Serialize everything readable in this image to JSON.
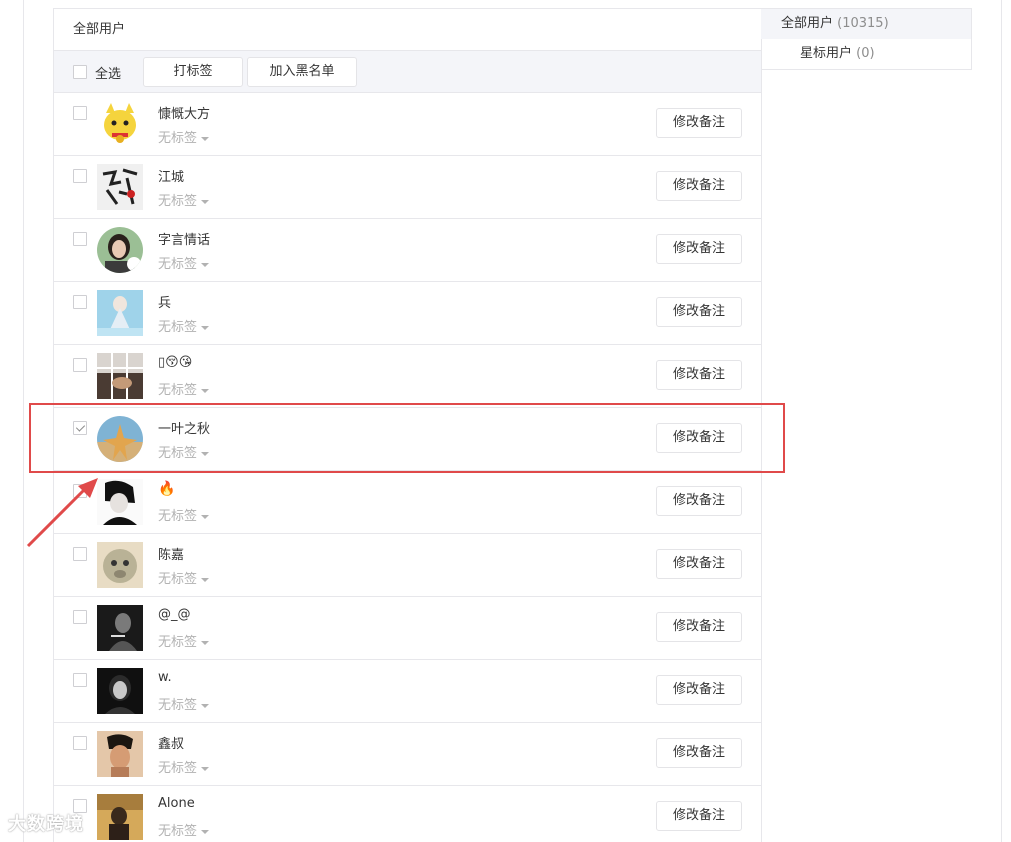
{
  "panel": {
    "title": "全部用户"
  },
  "toolbar": {
    "select_all": "全选",
    "tag_button": "打标签",
    "blacklist_button": "加入黑名单"
  },
  "sidebar": {
    "all_label": "全部用户",
    "all_count": "(10315)",
    "star_label": "星标用户",
    "star_count": "(0)"
  },
  "users": [
    {
      "name": "慷慨大方",
      "tag": "无标签",
      "checked": false
    },
    {
      "name": "江城",
      "tag": "无标签",
      "checked": false
    },
    {
      "name": "字言情话",
      "tag": "无标签",
      "checked": false
    },
    {
      "name": "兵",
      "tag": "无标签",
      "checked": false
    },
    {
      "name": "▯😚😘",
      "tag": "无标签",
      "checked": false
    },
    {
      "name": "一叶之秋",
      "tag": "无标签",
      "checked": true
    },
    {
      "name": "🔥",
      "tag": "无标签",
      "checked": false
    },
    {
      "name": "陈嘉",
      "tag": "无标签",
      "checked": false
    },
    {
      "name": "@_@",
      "tag": "无标签",
      "checked": false
    },
    {
      "name": "w.",
      "tag": "无标签",
      "checked": false
    },
    {
      "name": "鑫叔",
      "tag": "无标签",
      "checked": false
    },
    {
      "name": "Alone",
      "tag": "无标签",
      "checked": false
    }
  ],
  "row_button": "修改备注",
  "watermark": "大数跨境"
}
